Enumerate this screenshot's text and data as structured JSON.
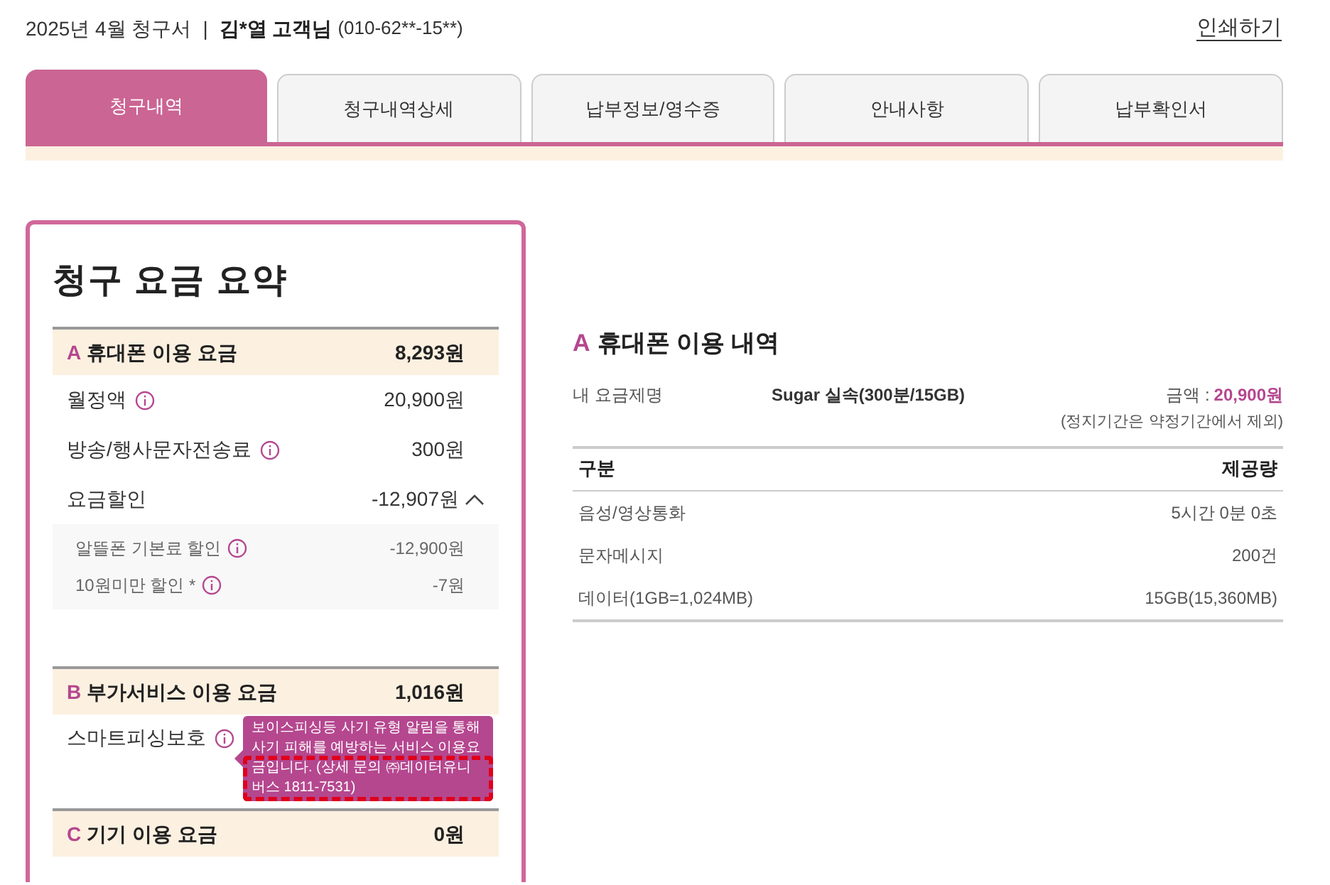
{
  "header": {
    "period": "2025년 4월 청구서",
    "separator": "|",
    "customer": "김*열 고객님",
    "phone": "(010-62**-15**)",
    "print_link": "인쇄하기"
  },
  "tabs": [
    {
      "label": "청구내역",
      "selected": true
    },
    {
      "label": "청구내역상세",
      "selected": false
    },
    {
      "label": "납부정보/영수증",
      "selected": false
    },
    {
      "label": "안내사항",
      "selected": false
    },
    {
      "label": "납부확인서",
      "selected": false
    }
  ],
  "summary": {
    "title": "청구 요금 요약",
    "sections": [
      {
        "letter": "A",
        "title": "휴대폰 이용 요금",
        "amount": "8,293원",
        "items": [
          {
            "label": "월정액",
            "info": true,
            "amount": "20,900원"
          },
          {
            "label": "방송/행사문자전송료",
            "info": true,
            "amount": "300원"
          },
          {
            "label": "요금할인",
            "amount": "-12,907원",
            "expanded": true,
            "children": [
              {
                "label": "알뜰폰 기본료 할인",
                "info": true,
                "amount": "-12,900원"
              },
              {
                "label": "10원미만 할인 *",
                "info": true,
                "amount": "-7원"
              }
            ]
          }
        ]
      },
      {
        "letter": "B",
        "title": "부가서비스 이용 요금",
        "amount": "1,016원",
        "items": [
          {
            "label": "스마트피싱보호",
            "info": true,
            "tooltip": "보이스피싱등 사기 유형 알림을 통해 사기 피해를 예방하는 서비스 이용요금입니다. (상세 문의 ㈜데이터유니버스 1811-7531)"
          }
        ]
      },
      {
        "letter": "C",
        "title": "기기 이용 요금",
        "amount": "0원"
      }
    ]
  },
  "usage": {
    "letter": "A",
    "title": "휴대폰 이용 내역",
    "plan_label": "내 요금제명",
    "plan_name": "Sugar 실속(300분/15GB)",
    "price_label": "금액 :",
    "price": "20,900원",
    "note": "(정지기간은 약정기간에서 제외)",
    "columns": [
      "구분",
      "제공량"
    ],
    "rows": [
      [
        "음성/영상통화",
        "5시간 0분 0초"
      ],
      [
        "문자메시지",
        "200건"
      ],
      [
        "데이터(1GB=1,024MB)",
        "15GB(15,360MB)"
      ]
    ]
  }
}
